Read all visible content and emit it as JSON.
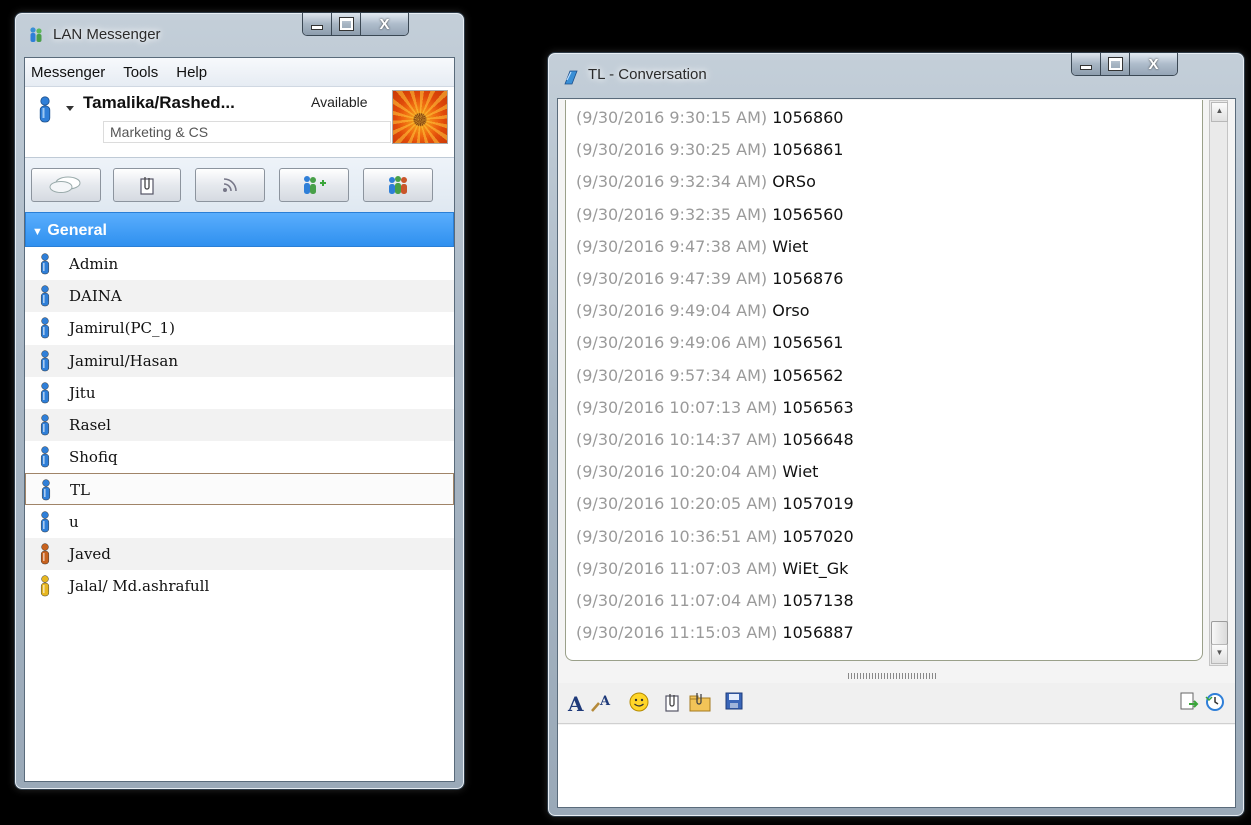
{
  "main_window": {
    "title": "LAN Messenger",
    "menu": [
      "Messenger",
      "Tools",
      "Help"
    ],
    "user_name": "Tamalika/Rashed...",
    "status": "Available",
    "user_note": "Marketing & CS",
    "group": "General",
    "contacts": [
      {
        "name": "Admin",
        "status_color": "#2f7fd8"
      },
      {
        "name": "DAINA",
        "status_color": "#2f7fd8"
      },
      {
        "name": "Jamirul(PC_1)",
        "status_color": "#2f7fd8"
      },
      {
        "name": "Jamirul/Hasan",
        "status_color": "#2f7fd8"
      },
      {
        "name": "Jitu",
        "status_color": "#2f7fd8"
      },
      {
        "name": "Rasel",
        "status_color": "#2f7fd8"
      },
      {
        "name": "Shofiq",
        "status_color": "#2f7fd8"
      },
      {
        "name": "TL",
        "status_color": "#2f7fd8"
      },
      {
        "name": "u",
        "status_color": "#2f7fd8"
      },
      {
        "name": "Javed",
        "status_color": "#c8621e"
      },
      {
        "name": "Jalal/ Md.ashrafull",
        "status_color": "#e7b720"
      }
    ],
    "selected_contact": "TL",
    "toolbar_icons": [
      "chat-icon",
      "file-transfer-icon",
      "broadcast-icon",
      "add-contact-icon",
      "group-icon"
    ]
  },
  "conversation_window": {
    "title": "TL - Conversation",
    "messages": [
      {
        "time": "(9/30/2016 9:30:15 AM)",
        "text": "1056860"
      },
      {
        "time": "(9/30/2016 9:30:25 AM)",
        "text": "1056861"
      },
      {
        "time": "(9/30/2016 9:32:34 AM)",
        "text": "ORSo"
      },
      {
        "time": "(9/30/2016 9:32:35 AM)",
        "text": "1056560"
      },
      {
        "time": "(9/30/2016 9:47:38 AM)",
        "text": "Wiet"
      },
      {
        "time": "(9/30/2016 9:47:39 AM)",
        "text": "1056876"
      },
      {
        "time": "(9/30/2016 9:49:04 AM)",
        "text": "Orso"
      },
      {
        "time": "(9/30/2016 9:49:06 AM)",
        "text": "1056561"
      },
      {
        "time": "(9/30/2016 9:57:34 AM)",
        "text": "1056562"
      },
      {
        "time": "(9/30/2016 10:07:13 AM)",
        "text": "1056563"
      },
      {
        "time": "(9/30/2016 10:14:37 AM)",
        "text": "1056648"
      },
      {
        "time": "(9/30/2016 10:20:04 AM)",
        "text": "Wiet"
      },
      {
        "time": "(9/30/2016 10:20:05 AM)",
        "text": "1057019"
      },
      {
        "time": "(9/30/2016 10:36:51 AM)",
        "text": "1057020"
      },
      {
        "time": "(9/30/2016 11:07:03 AM)",
        "text": "WiEt_Gk"
      },
      {
        "time": "(9/30/2016 11:07:04 AM)",
        "text": "1057138"
      },
      {
        "time": "(9/30/2016 11:15:03 AM)",
        "text": "1056887"
      }
    ],
    "format_icons": [
      "font-icon",
      "font-color-icon",
      "smiley-icon",
      "send-file-icon",
      "send-folder-icon",
      "save-icon",
      "history-export-icon",
      "history-icon"
    ]
  },
  "caption": {
    "minimize": "minimize-icon",
    "maximize": "maximize-icon",
    "close": "X"
  }
}
